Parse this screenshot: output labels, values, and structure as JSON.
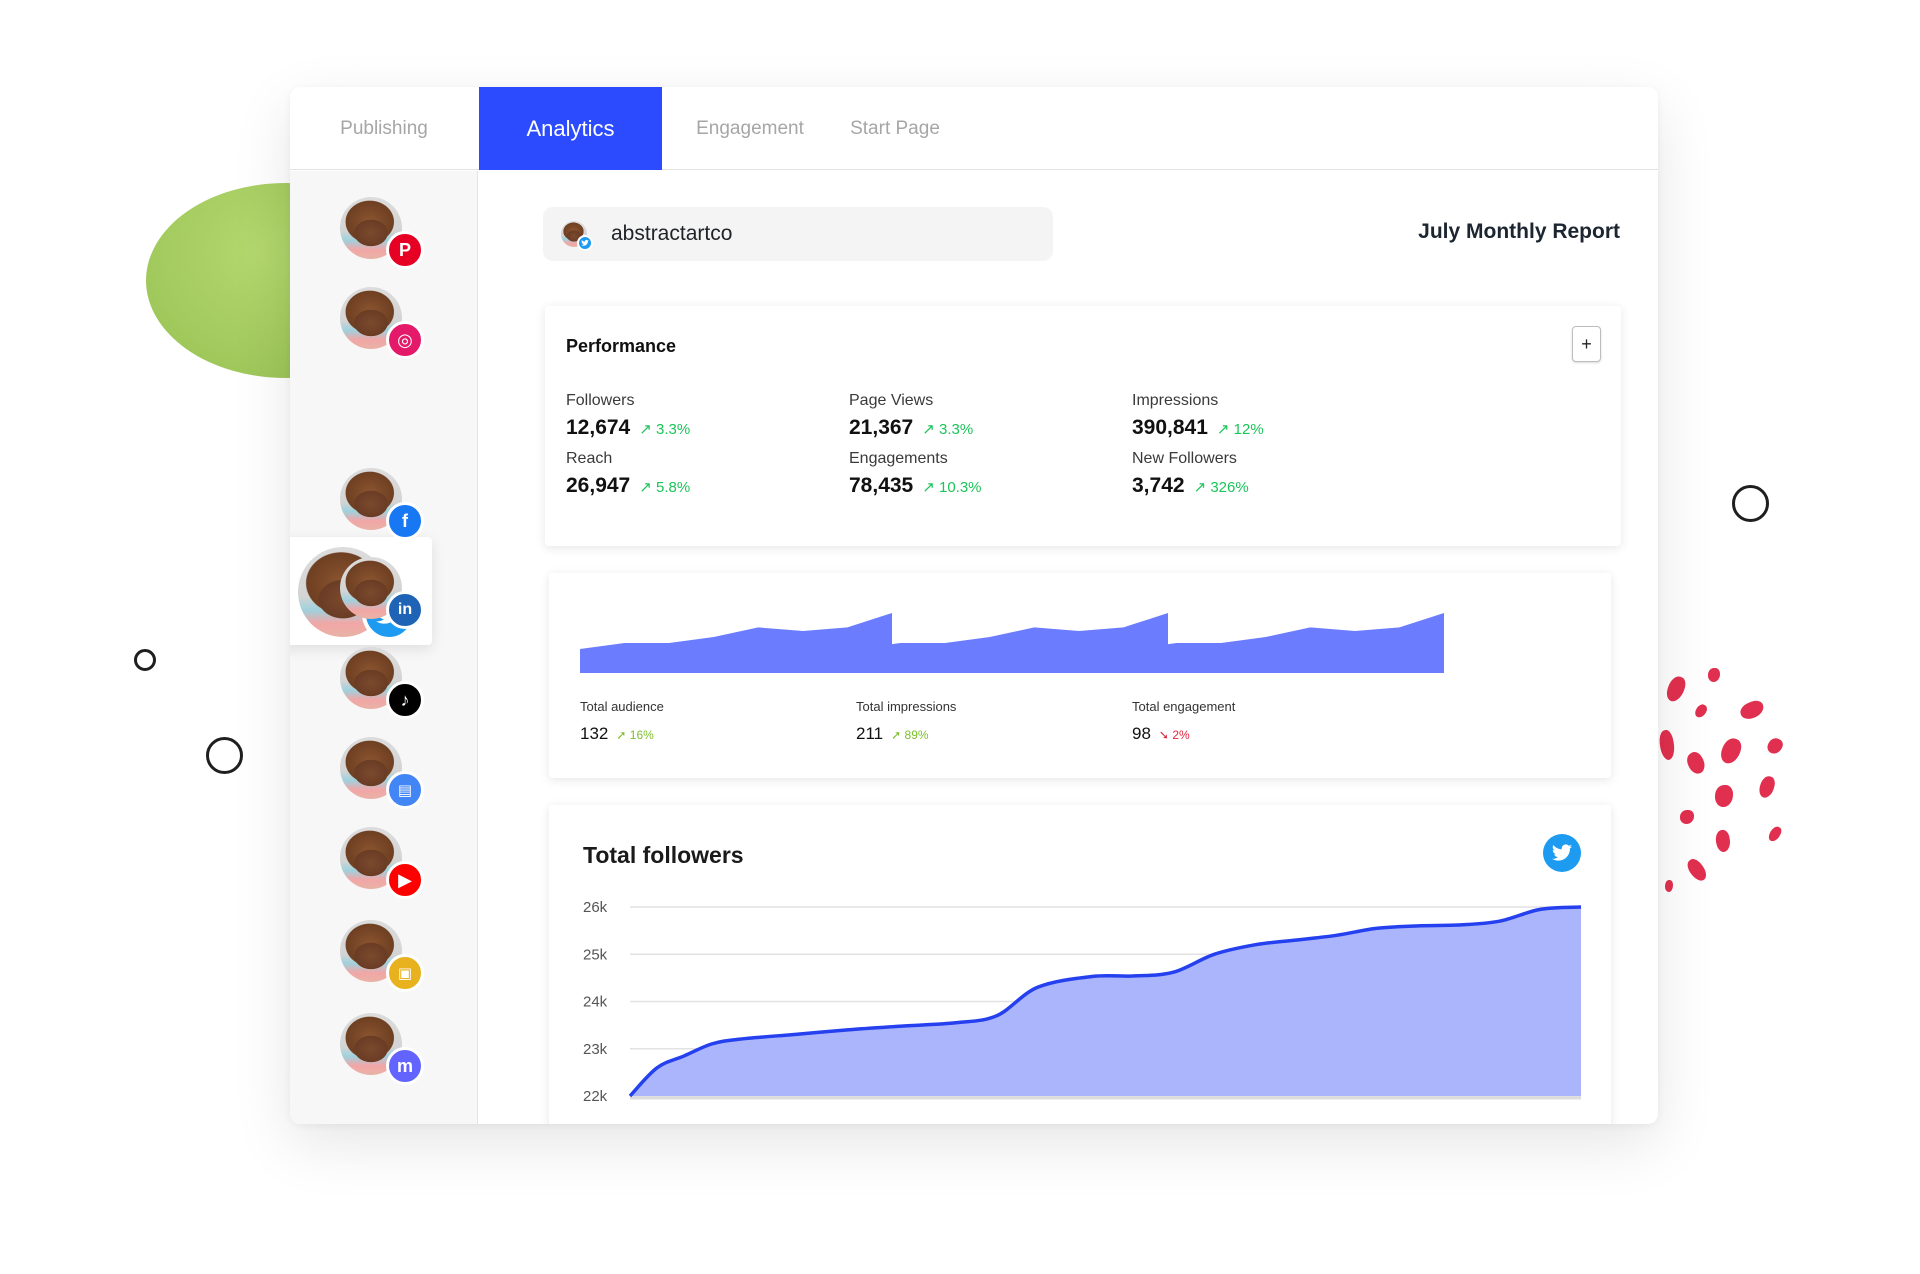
{
  "tabs": [
    {
      "label": "Publishing",
      "active": false
    },
    {
      "label": "Analytics",
      "active": true
    },
    {
      "label": "Engagement",
      "active": false
    },
    {
      "label": "Start Page",
      "active": false
    }
  ],
  "colors": {
    "accent": "#2c4bff",
    "positive": "#1cc45a",
    "mini_positive": "#7cc02c",
    "negative": "#e3263e",
    "chart_fill": "#6b7cff",
    "followers_fill": "#aab5fc",
    "followers_line": "#2540ee",
    "twitter": "#1d9bf0"
  },
  "sidebar": {
    "accounts": [
      {
        "network": "pinterest",
        "icon": "pinterest-icon",
        "color": "#e60023",
        "glyph": "P",
        "active": false
      },
      {
        "network": "instagram",
        "icon": "instagram-icon",
        "color": "#e4196a",
        "glyph": "◎",
        "active": false
      },
      {
        "network": "twitter",
        "icon": "twitter-icon",
        "color": "#1d9bf0",
        "glyph": "🐦",
        "active": true
      },
      {
        "network": "facebook",
        "icon": "facebook-icon",
        "color": "#1877f2",
        "glyph": "f",
        "active": false
      },
      {
        "network": "linkedin",
        "icon": "linkedin-icon",
        "color": "#1e63b5",
        "glyph": "in",
        "active": false
      },
      {
        "network": "tiktok",
        "icon": "tiktok-icon",
        "color": "#000000",
        "glyph": "♪",
        "active": false
      },
      {
        "network": "google-business",
        "icon": "google-business-icon",
        "color": "#4285f4",
        "glyph": "▤",
        "active": false
      },
      {
        "network": "youtube",
        "icon": "youtube-icon",
        "color": "#ff0000",
        "glyph": "▶",
        "active": false
      },
      {
        "network": "start-page",
        "icon": "start-page-icon",
        "color": "#e8b21e",
        "glyph": "▣",
        "active": false
      },
      {
        "network": "mastodon",
        "icon": "mastodon-icon",
        "color": "#6364ff",
        "glyph": "m",
        "active": false
      }
    ]
  },
  "account": {
    "name": "abstractartco",
    "network": "twitter"
  },
  "report_title": "July Monthly Report",
  "performance": {
    "title": "Performance",
    "add_label": "+",
    "metrics": [
      {
        "label": "Followers",
        "value": "12,674",
        "change": "3.3%",
        "direction": "up"
      },
      {
        "label": "Page Views",
        "value": "21,367",
        "change": "3.3%",
        "direction": "up"
      },
      {
        "label": "Impressions",
        "value": "390,841",
        "change": "12%",
        "direction": "up"
      },
      {
        "label": "Reach",
        "value": "26,947",
        "change": "5.8%",
        "direction": "up"
      },
      {
        "label": "Engagements",
        "value": "78,435",
        "change": "10.3%",
        "direction": "up"
      },
      {
        "label": "New Followers",
        "value": "3,742",
        "change": "326%",
        "direction": "up"
      }
    ]
  },
  "summary": [
    {
      "label": "Total audience",
      "value": "132",
      "change": "16%",
      "direction": "up",
      "arrow": "➚"
    },
    {
      "label": "Total impressions",
      "value": "211",
      "change": "89%",
      "direction": "up",
      "arrow": "➚"
    },
    {
      "label": "Total engagement",
      "value": "98",
      "change": "2%",
      "direction": "down",
      "arrow": "➘"
    }
  ],
  "chart_data": [
    {
      "type": "area",
      "title": "Total audience",
      "x": [
        0,
        1,
        2,
        3,
        4,
        5,
        6,
        7
      ],
      "values": [
        2,
        2.5,
        2.5,
        3.0,
        3.8,
        3.5,
        3.8,
        5.0
      ],
      "ylim": [
        0,
        5
      ]
    },
    {
      "type": "area",
      "title": "Total impressions",
      "x": [
        0,
        1,
        2,
        3,
        4,
        5,
        6,
        7
      ],
      "values": [
        2,
        2.5,
        2.5,
        3.0,
        3.8,
        3.5,
        3.8,
        5.0
      ],
      "ylim": [
        0,
        5
      ]
    },
    {
      "type": "area",
      "title": "Total engagement",
      "x": [
        0,
        1,
        2,
        3,
        4,
        5,
        6,
        7
      ],
      "values": [
        2,
        2.5,
        2.5,
        3.0,
        3.8,
        3.5,
        3.8,
        5.0
      ],
      "ylim": [
        0,
        5
      ]
    },
    {
      "type": "area",
      "title": "Total followers",
      "xlabel": "",
      "ylabel": "",
      "yticks": [
        "26k",
        "25k",
        "24k",
        "23k",
        "22k"
      ],
      "ylim": [
        22000,
        26000
      ],
      "grid": true,
      "x": [
        0,
        2,
        4,
        6,
        8,
        12,
        16,
        20,
        24,
        27,
        30,
        34,
        37,
        40,
        43,
        46,
        49,
        52,
        55,
        58,
        61,
        64,
        67,
        70
      ],
      "values": [
        22000,
        22600,
        22850,
        23100,
        23200,
        23300,
        23400,
        23480,
        23550,
        23700,
        24300,
        24530,
        24540,
        24620,
        25000,
        25200,
        25300,
        25400,
        25550,
        25600,
        25620,
        25700,
        25950,
        26000
      ]
    }
  ]
}
